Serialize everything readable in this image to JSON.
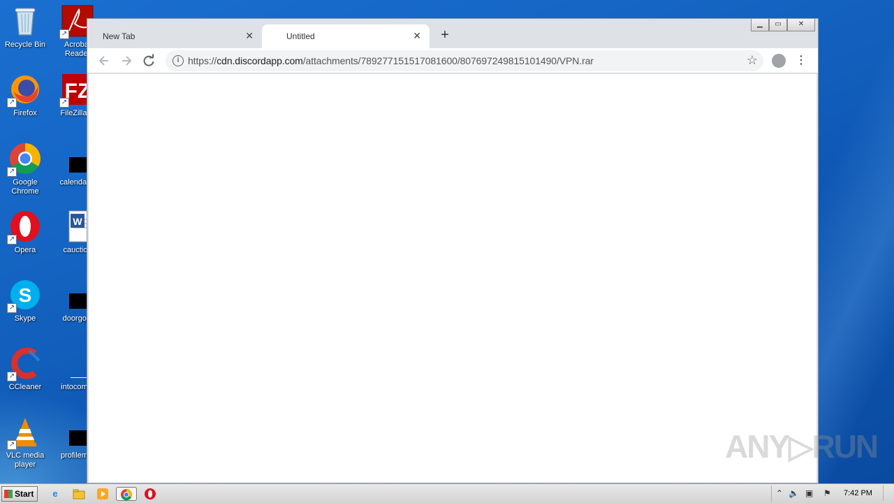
{
  "desktop": {
    "icons": [
      {
        "label": "Recycle Bin",
        "icon": "recycle-bin-icon"
      },
      {
        "label": "Acrobat Reader",
        "icon": "acrobat-reader-icon"
      },
      {
        "label": "Firefox",
        "icon": "firefox-icon"
      },
      {
        "label": "FileZilla C",
        "icon": "filezilla-icon"
      },
      {
        "label": "Google Chrome",
        "icon": "chrome-icon"
      },
      {
        "label": "calendarin",
        "icon": "file-icon"
      },
      {
        "label": "Opera",
        "icon": "opera-icon"
      },
      {
        "label": "cauction",
        "icon": "word-document-icon"
      },
      {
        "label": "Skype",
        "icon": "skype-icon"
      },
      {
        "label": "doorgold",
        "icon": "file-icon"
      },
      {
        "label": "CCleaner",
        "icon": "ccleaner-icon"
      },
      {
        "label": "intocomm",
        "icon": "file-icon"
      },
      {
        "label": "VLC media player",
        "icon": "vlc-icon"
      },
      {
        "label": "profilemat",
        "icon": "file-icon"
      }
    ]
  },
  "browser": {
    "tabs": [
      {
        "title": "New Tab",
        "active": false
      },
      {
        "title": "Untitled",
        "active": true
      }
    ],
    "new_tab_symbol": "+",
    "close_symbol": "✕",
    "url_scheme": "https://",
    "url_host": "cdn.discordapp.com",
    "url_path": "/attachments/789277151517081600/807697249815101490/VPN.rar",
    "window_controls": {
      "minimize": "▁",
      "maximize": "▭",
      "close": "✕"
    }
  },
  "watermark": {
    "text": "ANY▷RUN"
  },
  "taskbar": {
    "start_label": "Start",
    "pinned": [
      "internet-explorer-icon",
      "explorer-icon",
      "media-player-icon",
      "chrome-icon",
      "opera-icon"
    ],
    "clock": "7:42 PM"
  }
}
